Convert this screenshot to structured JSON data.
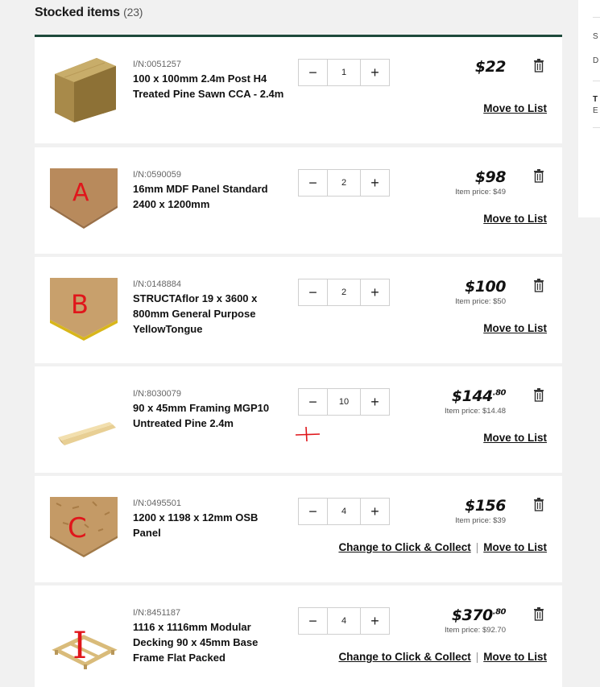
{
  "header": {
    "title": "Stocked items",
    "count": "(23)"
  },
  "side_panel": {
    "t1": "S",
    "t2": "D",
    "t3": "T",
    "t4": "E"
  },
  "labels": {
    "move_to_list": "Move to List",
    "change_to_click_collect": "Change to Click & Collect",
    "separator": "|"
  },
  "items": [
    {
      "sku": "I/N:0051257",
      "name": "100 x 100mm 2.4m Post H4 Treated Pine Sawn CCA - 2.4m",
      "qty": "1",
      "price": "$22",
      "price_cents": "",
      "item_price": "",
      "annotation": ""
    },
    {
      "sku": "I/N:0590059",
      "name": "16mm MDF Panel Standard 2400 x 1200mm",
      "qty": "2",
      "price": "$98",
      "price_cents": "",
      "item_price": "Item price: $49",
      "annotation": "A"
    },
    {
      "sku": "I/N:0148884",
      "name": "STRUCTAflor 19 x 3600 x 800mm General Purpose YellowTongue",
      "qty": "2",
      "price": "$100",
      "price_cents": "",
      "item_price": "Item price: $50",
      "annotation": "B"
    },
    {
      "sku": "I/N:8030079",
      "name": "90 x 45mm Framing MGP10 Untreated Pine 2.4m",
      "qty": "10",
      "price": "$144",
      "price_cents": ".80",
      "item_price": "Item price: $14.48",
      "annotation": "+"
    },
    {
      "sku": "I/N:0495501",
      "name": "1200 x 1198 x 12mm OSB Panel",
      "qty": "4",
      "price": "$156",
      "price_cents": "",
      "item_price": "Item price: $39",
      "annotation": "C"
    },
    {
      "sku": "I/N:8451187",
      "name": "1116 x 1116mm Modular Decking 90 x 45mm Base Frame Flat Packed",
      "qty": "4",
      "price": "$370",
      "price_cents": ".80",
      "item_price": "Item price: $92.70",
      "annotation": "I"
    }
  ],
  "colors": {
    "accent": "#1e4a3c",
    "annotation": "#e0161b"
  }
}
